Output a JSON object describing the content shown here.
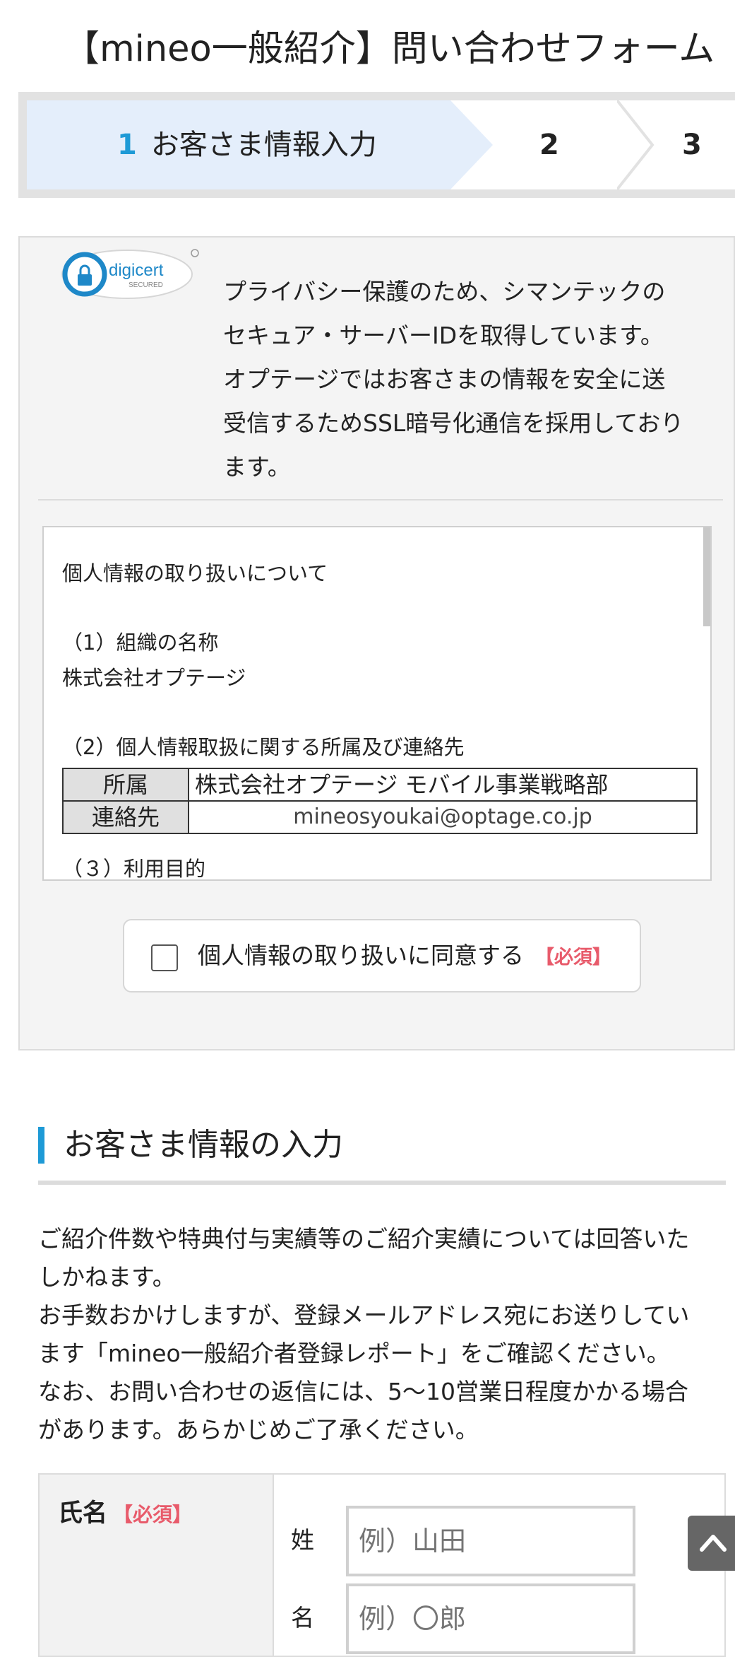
{
  "page": {
    "title": "【mineo一般紹介】問い合わせフォーム"
  },
  "steps": [
    {
      "num": "1",
      "label": "お客さま情報入力"
    },
    {
      "num": "2",
      "label": ""
    },
    {
      "num": "3",
      "label": ""
    }
  ],
  "security": {
    "logo_text": "digicert",
    "logo_sub": "SECURED",
    "text_lines": [
      "プライバシー保護のため、シマンテックの",
      "セキュア・サーバーIDを取得しています。",
      "オプテージではお客さまの情報を安全に送",
      "受信するためSSL暗号化通信を採用しており",
      "ます。"
    ]
  },
  "privacy": {
    "heading": "個人情報の取り扱いについて",
    "item1_title": "（1）組織の名称",
    "item1_body": "株式会社オプテージ",
    "item2_title": "（2）個人情報取扱に関する所属及び連絡先",
    "table": [
      {
        "label": "所属",
        "value": "株式会社オプテージ モバイル事業戦略部"
      },
      {
        "label": "連絡先",
        "value": "mineosyoukai@optage.co.jp"
      }
    ],
    "item3_partial": "（３）利用目的"
  },
  "agree": {
    "label": "個人情報の取り扱いに同意する",
    "required": "【必須】"
  },
  "section": {
    "title": "お客さま情報の入力"
  },
  "notice_lines": [
    "ご紹介件数や特典付与実績等のご紹介実績については回答いた",
    "しかねます。",
    "お手数おかけしますが、登録メールアドレス宛にお送りしてい",
    "ます「mineo一般紹介者登録レポート」をご確認ください。",
    "なお、お問い合わせの返信には、5〜10営業日程度かかる場合",
    "があります。あらかじめご了承ください。"
  ],
  "form": {
    "name_label": "氏名",
    "required": "【必須】",
    "last_name_label": "姓",
    "last_name_placeholder": "例）山田",
    "first_name_label": "名",
    "first_name_placeholder": "例）〇郎"
  },
  "colors": {
    "accent": "#1e9ad6",
    "required": "#e85b6b",
    "step_active_bg": "#e4eefb"
  },
  "icons": {
    "back_to_top": "chevron-up-icon",
    "lock": "lock-icon"
  }
}
